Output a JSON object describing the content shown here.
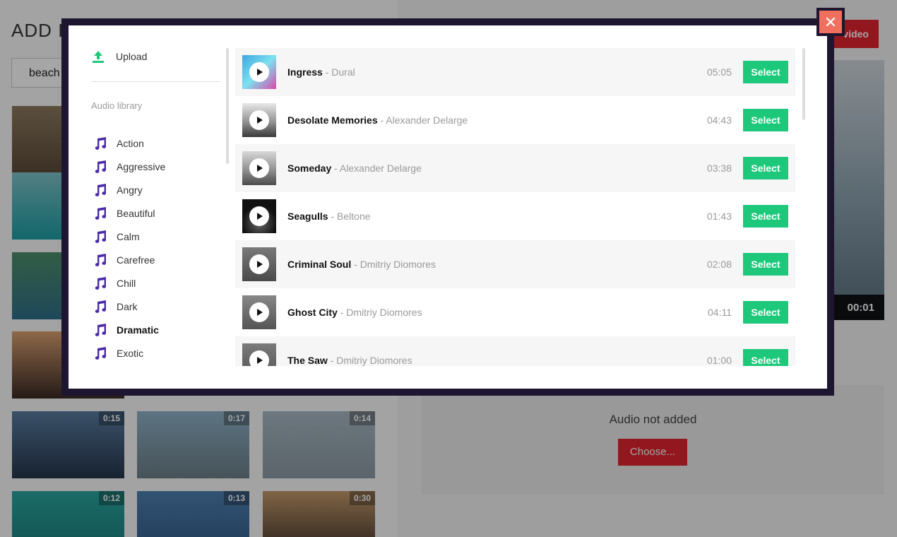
{
  "background": {
    "title": "ADD IT",
    "search_value": "beach",
    "add_video_label": "video",
    "preview_time": "00:01",
    "audio_status": "Audio not added",
    "choose_label": "Choose...",
    "thumbnails": [
      {
        "duration": ""
      },
      {
        "duration": ""
      },
      {
        "duration": ""
      },
      {
        "duration": ""
      },
      {
        "duration": "0:15"
      },
      {
        "duration": "0:17"
      },
      {
        "duration": "0:14"
      },
      {
        "duration": "0:12"
      },
      {
        "duration": "0:13"
      },
      {
        "duration": "0:30"
      }
    ]
  },
  "modal": {
    "close_icon": "close-icon",
    "upload_label": "Upload",
    "library_title": "Audio library",
    "genres": [
      {
        "label": "Action"
      },
      {
        "label": "Aggressive"
      },
      {
        "label": "Angry"
      },
      {
        "label": "Beautiful"
      },
      {
        "label": "Calm"
      },
      {
        "label": "Carefree"
      },
      {
        "label": "Chill"
      },
      {
        "label": "Dark"
      },
      {
        "label": "Dramatic",
        "active": true
      },
      {
        "label": "Exotic"
      }
    ],
    "select_label": "Select",
    "tracks": [
      {
        "title": "Ingress",
        "artist": "Dural",
        "duration": "05:05"
      },
      {
        "title": "Desolate Memories",
        "artist": "Alexander Delarge",
        "duration": "04:43"
      },
      {
        "title": "Someday",
        "artist": "Alexander Delarge",
        "duration": "03:38"
      },
      {
        "title": "Seagulls",
        "artist": "Beltone",
        "duration": "01:43"
      },
      {
        "title": "Criminal Soul",
        "artist": "Dmitriy Diomores",
        "duration": "02:08"
      },
      {
        "title": "Ghost City",
        "artist": "Dmitriy Diomores",
        "duration": "04:11"
      },
      {
        "title": "The Saw",
        "artist": "Dmitriy Diomores",
        "duration": "01:00"
      }
    ]
  },
  "colors": {
    "accent_red": "#e0242f",
    "select_green": "#1ec87a",
    "genre_icon_purple": "#4a2aa8",
    "upload_icon_green": "#1ec87a"
  }
}
